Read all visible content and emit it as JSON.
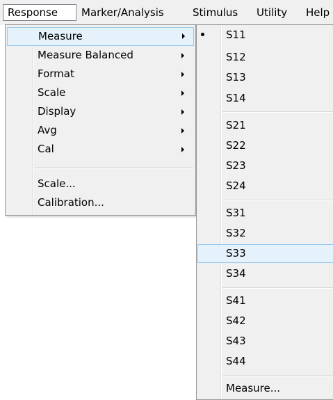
{
  "menubar": {
    "items": [
      "Response",
      "Marker/Analysis",
      "Stimulus",
      "Utility",
      "Help"
    ],
    "active_index": 0
  },
  "response_menu": {
    "items": [
      {
        "label": "Measure",
        "submenu": true,
        "highlighted": true
      },
      {
        "label": "Measure Balanced",
        "submenu": true
      },
      {
        "label": "Format",
        "submenu": true
      },
      {
        "label": "Scale",
        "submenu": true
      },
      {
        "label": "Display",
        "submenu": true
      },
      {
        "label": "Avg",
        "submenu": true
      },
      {
        "label": "Cal",
        "submenu": true
      },
      {
        "label": "Scale...",
        "submenu": false
      },
      {
        "label": "Calibration...",
        "submenu": false
      }
    ]
  },
  "measure_submenu": {
    "items": [
      {
        "label": "S11",
        "checked": true
      },
      {
        "label": "S12"
      },
      {
        "label": "S13"
      },
      {
        "label": "S14"
      },
      {
        "label": "S21"
      },
      {
        "label": "S22"
      },
      {
        "label": "S23"
      },
      {
        "label": "S24"
      },
      {
        "label": "S31"
      },
      {
        "label": "S32"
      },
      {
        "label": "S33",
        "highlighted": true
      },
      {
        "label": "S34"
      },
      {
        "label": "S41"
      },
      {
        "label": "S42"
      },
      {
        "label": "S43"
      },
      {
        "label": "S44"
      },
      {
        "label": "Measure..."
      }
    ]
  },
  "colors": {
    "menu_background": "#f0f0f0",
    "highlight_fill": "#e5f1fb",
    "highlight_border": "#99c9ef"
  }
}
